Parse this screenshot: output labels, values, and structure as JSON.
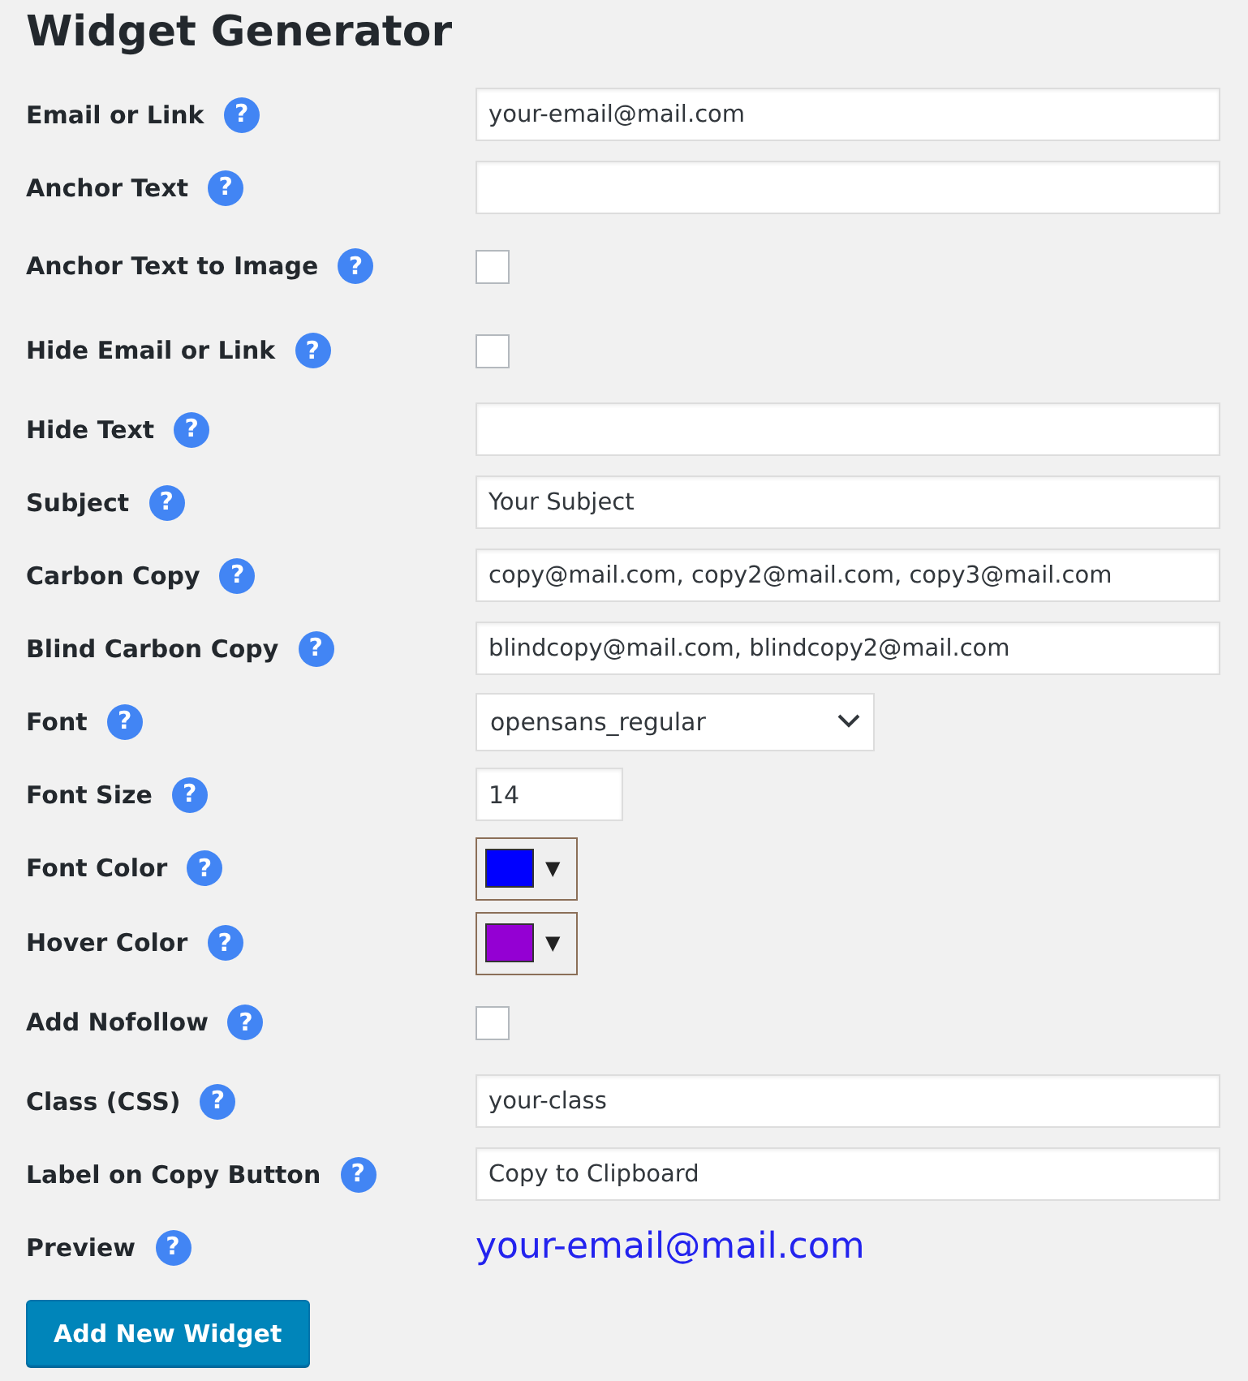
{
  "title": "Widget Generator",
  "fields": [
    {
      "kind": "text",
      "label": "Email or Link",
      "help": "?",
      "value": "your-email@mail.com"
    },
    {
      "kind": "text",
      "label": "Anchor Text",
      "help": "?"
    },
    {
      "kind": "checkbox",
      "label": "Anchor Text to Image",
      "help": "?",
      "checked": false
    },
    {
      "kind": "checkbox",
      "label": "Hide Email or Link",
      "help": "?",
      "checked": false
    },
    {
      "kind": "text",
      "label": "Hide Text",
      "help": "?"
    },
    {
      "kind": "text",
      "label": "Subject",
      "help": "?",
      "value": "Your Subject"
    },
    {
      "kind": "text",
      "label": "Carbon Copy",
      "help": "?",
      "value": "copy@mail.com, copy2@mail.com, copy3@mail.com"
    },
    {
      "kind": "text",
      "label": "Blind Carbon Copy",
      "help": "?",
      "value": "blindcopy@mail.com, blindcopy2@mail.com"
    },
    {
      "kind": "select",
      "label": "Font",
      "help": "?",
      "value": "opensans_regular"
    },
    {
      "kind": "number",
      "label": "Font Size",
      "help": "?",
      "value": "14"
    },
    {
      "kind": "color",
      "label": "Font Color",
      "help": "?",
      "color": "#0000ff",
      "arrow": "▼"
    },
    {
      "kind": "color",
      "label": "Hover Color",
      "help": "?",
      "color": "#9400d3",
      "arrow": "▼"
    },
    {
      "kind": "checkbox",
      "label": "Add Nofollow",
      "help": "?",
      "checked": false
    },
    {
      "kind": "text",
      "label": "Class (CSS)",
      "help": "?",
      "value": "your-class"
    },
    {
      "kind": "text",
      "label": "Label on Copy Button",
      "help": "?",
      "value": "Copy to Clipboard"
    },
    {
      "kind": "preview",
      "label": "Preview",
      "help": "?",
      "value": "your-email@mail.com"
    }
  ],
  "button": "Add New Widget"
}
